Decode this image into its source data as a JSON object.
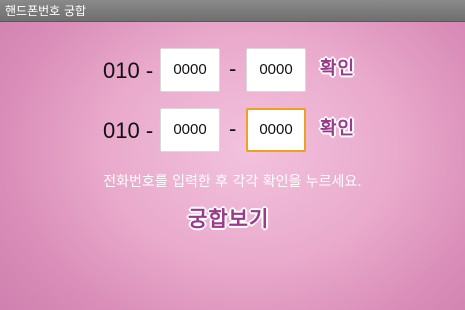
{
  "app": {
    "title": "핸드폰번호 궁합"
  },
  "phone1": {
    "prefix": "010 -",
    "middle": "0000",
    "dash": "-",
    "last": "0000",
    "confirm_label": "확인"
  },
  "phone2": {
    "prefix": "010 -",
    "middle": "0000",
    "dash": "-",
    "last": "0000",
    "confirm_label": "확인"
  },
  "instruction": "전화번호를 입력한 후 각각 확인을 누르세요.",
  "view_button_label": "궁합보기",
  "colors": {
    "accent_text": "#9a3a8a",
    "focus_border": "#f0a020",
    "background": "#e9a9cb"
  }
}
